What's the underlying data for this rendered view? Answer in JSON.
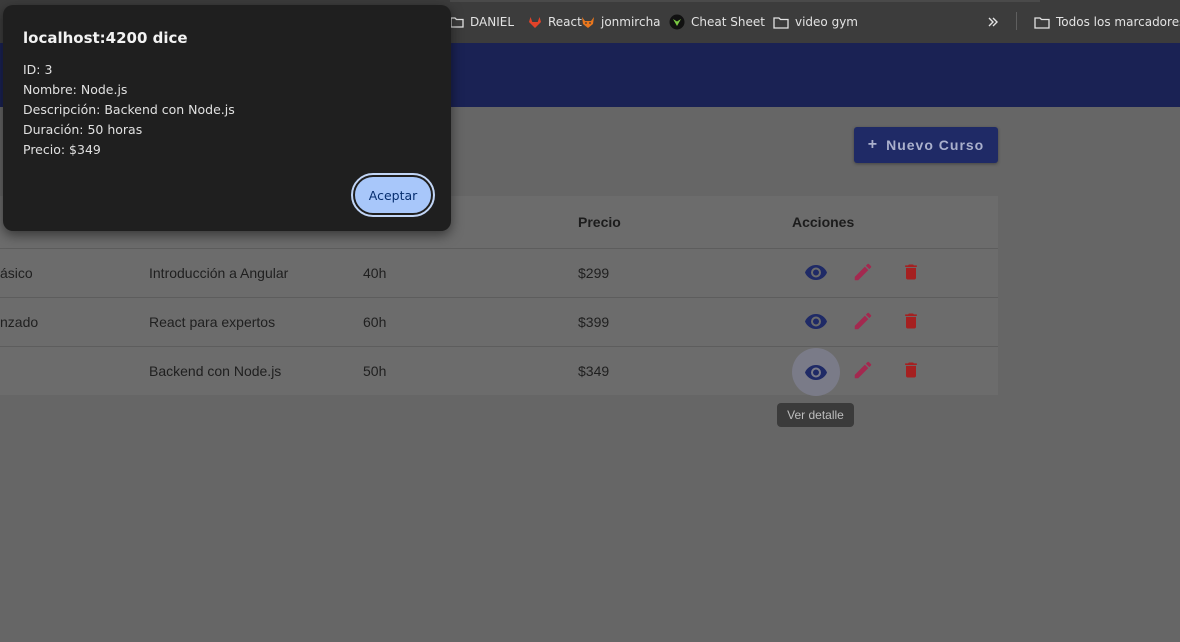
{
  "bookmarks": {
    "items": [
      {
        "label": "DANIEL",
        "icon": "folder-icon"
      },
      {
        "label": "React",
        "icon": "gitlab-icon"
      },
      {
        "label": "jonmircha",
        "icon": "fox-icon"
      },
      {
        "label": "Cheat Sheet",
        "icon": "cheat-sheet-icon"
      },
      {
        "label": "video gym",
        "icon": "folder-icon"
      }
    ],
    "overflow_icon": "chevron-double-right-icon",
    "all_bookmarks_label": "Todos los marcadores"
  },
  "toolbar": {
    "new_course_label": "Nuevo Curso",
    "new_course_icon": "plus-icon"
  },
  "table": {
    "headers": {
      "precio": "Precio",
      "acciones": "Acciones"
    },
    "rows": [
      {
        "nivel": "ásico",
        "descripcion": "Introducción a Angular",
        "duracion": "40h",
        "precio": "$299"
      },
      {
        "nivel": "nzado",
        "descripcion": "React para expertos",
        "duracion": "60h",
        "precio": "$399"
      },
      {
        "nivel": "",
        "descripcion": "Backend con Node.js",
        "duracion": "50h",
        "precio": "$349"
      }
    ],
    "tooltip": "Ver detalle"
  },
  "dialog": {
    "title": "localhost:4200 dice",
    "lines": [
      "ID: 3",
      "Nombre: Node.js",
      "Descripción: Backend con Node.js",
      "Duración: 50 horas",
      "Precio: $349"
    ],
    "ok_label": "Aceptar"
  },
  "colors": {
    "header_bg": "#1a2254",
    "view_icon": "#1f2a66",
    "edit_icon": "#a3294f",
    "delete_icon": "#a52020",
    "dialog_bg": "#1f1f1f",
    "ok_button": "#a8c7fa"
  }
}
